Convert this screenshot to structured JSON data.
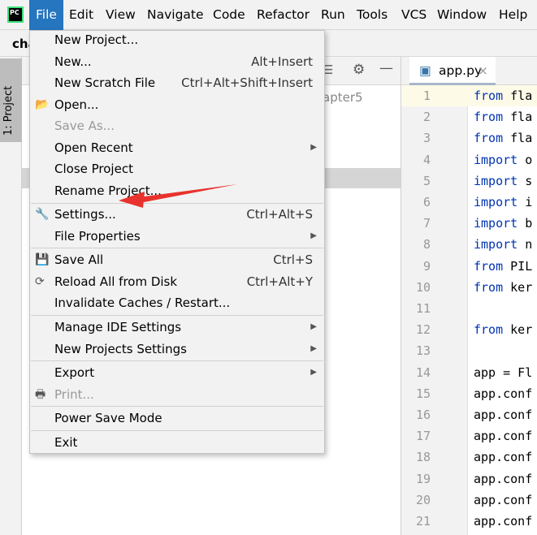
{
  "menubar": {
    "items": [
      "File",
      "Edit",
      "View",
      "Navigate",
      "Code",
      "Refactor",
      "Run",
      "Tools",
      "VCS",
      "Window",
      "Help"
    ],
    "active": "File"
  },
  "toolbar": {
    "breadcrumb": "cha"
  },
  "sidebar": {
    "project_tab": "1: Project"
  },
  "project_panel": {
    "path_fragment": "apter5"
  },
  "editor": {
    "tab": "app.py",
    "lines": [
      "from fla",
      "from fla",
      "from fla",
      "import o",
      "import s",
      "import i",
      "import b",
      "import n",
      "from PIL",
      "from ker",
      "",
      "from ker",
      "",
      "app = Fl",
      "app.conf",
      "app.conf",
      "app.conf",
      "app.conf",
      "app.conf",
      "app.conf",
      "app.conf"
    ]
  },
  "file_menu": {
    "items": [
      {
        "label": "New Project...",
        "shortcut": "",
        "submenu": false,
        "disabled": false,
        "icon": ""
      },
      {
        "label": "New...",
        "shortcut": "Alt+Insert",
        "submenu": false,
        "disabled": false,
        "icon": ""
      },
      {
        "label": "New Scratch File",
        "shortcut": "Ctrl+Alt+Shift+Insert",
        "submenu": false,
        "disabled": false,
        "icon": ""
      },
      {
        "label": "Open...",
        "shortcut": "",
        "submenu": false,
        "disabled": false,
        "icon": "folder-icon"
      },
      {
        "label": "Save As...",
        "shortcut": "",
        "submenu": false,
        "disabled": true,
        "icon": ""
      },
      {
        "label": "Open Recent",
        "shortcut": "",
        "submenu": true,
        "disabled": false,
        "icon": ""
      },
      {
        "label": "Close Project",
        "shortcut": "",
        "submenu": false,
        "disabled": false,
        "icon": ""
      },
      {
        "label": "Rename Project...",
        "shortcut": "",
        "submenu": false,
        "disabled": false,
        "icon": ""
      },
      {
        "label": "Settings...",
        "shortcut": "Ctrl+Alt+S",
        "submenu": false,
        "disabled": false,
        "icon": "wrench-icon"
      },
      {
        "label": "File Properties",
        "shortcut": "",
        "submenu": true,
        "disabled": false,
        "icon": ""
      },
      {
        "label": "Save All",
        "shortcut": "Ctrl+S",
        "submenu": false,
        "disabled": false,
        "icon": "save-icon"
      },
      {
        "label": "Reload All from Disk",
        "shortcut": "Ctrl+Alt+Y",
        "submenu": false,
        "disabled": false,
        "icon": "reload-icon"
      },
      {
        "label": "Invalidate Caches / Restart...",
        "shortcut": "",
        "submenu": false,
        "disabled": false,
        "icon": ""
      },
      {
        "label": "Manage IDE Settings",
        "shortcut": "",
        "submenu": true,
        "disabled": false,
        "icon": ""
      },
      {
        "label": "New Projects Settings",
        "shortcut": "",
        "submenu": true,
        "disabled": false,
        "icon": ""
      },
      {
        "label": "Export",
        "shortcut": "",
        "submenu": true,
        "disabled": false,
        "icon": ""
      },
      {
        "label": "Print...",
        "shortcut": "",
        "submenu": false,
        "disabled": true,
        "icon": "print-icon"
      },
      {
        "label": "Power Save Mode",
        "shortcut": "",
        "submenu": false,
        "disabled": false,
        "icon": ""
      },
      {
        "label": "Exit",
        "shortcut": "",
        "submenu": false,
        "disabled": false,
        "icon": ""
      }
    ]
  },
  "colors": {
    "accent": "#2675bf",
    "annotation_arrow": "#e8322d",
    "keyword": "#0033b3"
  }
}
